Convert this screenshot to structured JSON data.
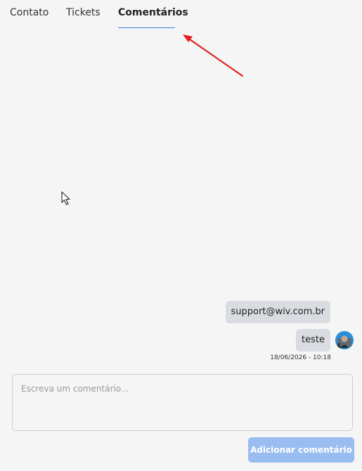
{
  "tabs": {
    "contato": "Contato",
    "tickets": "Tickets",
    "comentarios": "Comentários",
    "active": "comentarios"
  },
  "comments": {
    "items": [
      {
        "text": "support@wiv.com.br"
      },
      {
        "text": "teste"
      }
    ],
    "timestamp": "18/06/2026 - 10:18"
  },
  "composer": {
    "placeholder": "Escreva um comentário...",
    "value": "",
    "submit_label": "Adicionar comentário"
  },
  "colors": {
    "tab_underline": "#3a7bd5",
    "bubble": "#d9dde2",
    "button_disabled": "#99bdf0",
    "annotation_arrow": "#e02020",
    "avatar_bg": "#2b8fd8"
  },
  "icons": {
    "arrow": "annotation-arrow-icon",
    "cursor": "mouse-pointer-icon",
    "avatar": "user-avatar"
  }
}
